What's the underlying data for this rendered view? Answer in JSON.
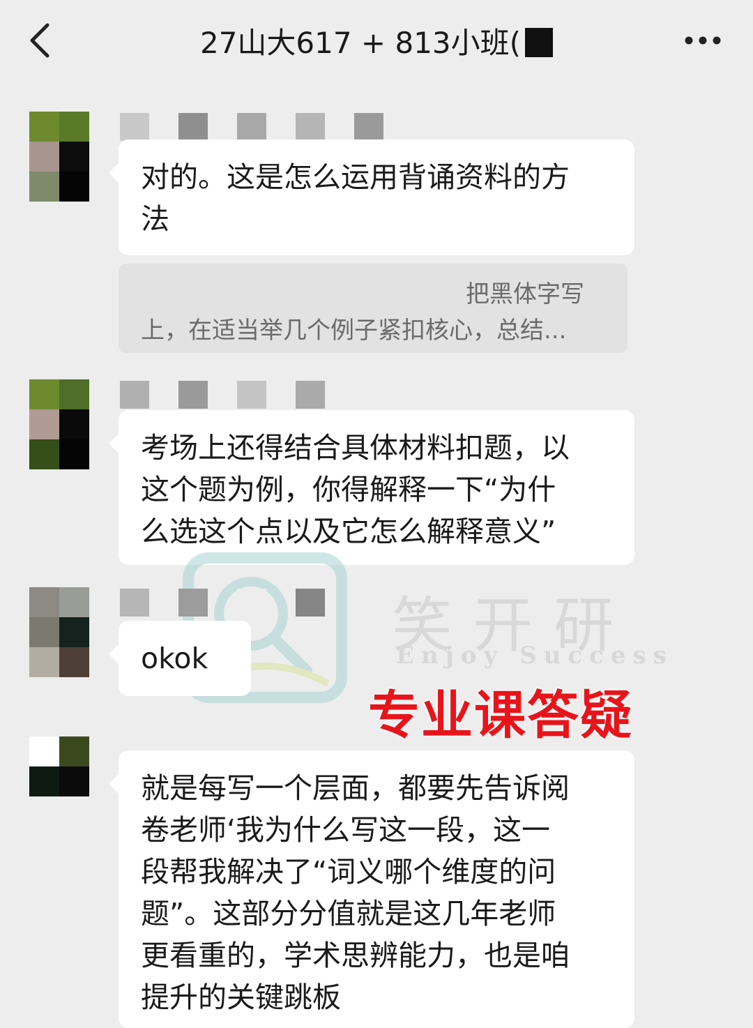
{
  "header": {
    "title": "27山大617 + 813小班(",
    "back_icon": "chevron-left-icon",
    "more_icon": "more-dots-icon"
  },
  "messages": [
    {
      "text_lines": [
        "对的。这是怎么运用背诵资料的方",
        "法"
      ]
    },
    {
      "quote_lines": [
        "把黑体字写",
        "上，在适当举几个例子紧扣核心，总结..."
      ]
    },
    {
      "text_lines": [
        "考场上还得结合具体材料扣题，以",
        "这个题为例，你得解释一下“为什",
        "么选这个点以及它怎么解释意义”"
      ]
    },
    {
      "text_lines": [
        "okok"
      ]
    },
    {
      "text_lines": [
        "就是每写一个层面，都要先告诉阅",
        "卷老师‘我为什么写这一段，这一",
        "段帮我解决了“词义哪个维度的问",
        "题”。这部分分值就是这几年老师",
        "更看重的，学术思辨能力，也是咱",
        "提升的关键跳板"
      ]
    }
  ],
  "watermark": {
    "brand_cn": "笑开研",
    "brand_en": "Enjoy Success"
  },
  "stamp_text": "专业课答疑",
  "colors": {
    "background": "#ededed",
    "bubble": "#ffffff",
    "quote_bg": "#e2e2e2",
    "stamp": "#e8141b"
  }
}
